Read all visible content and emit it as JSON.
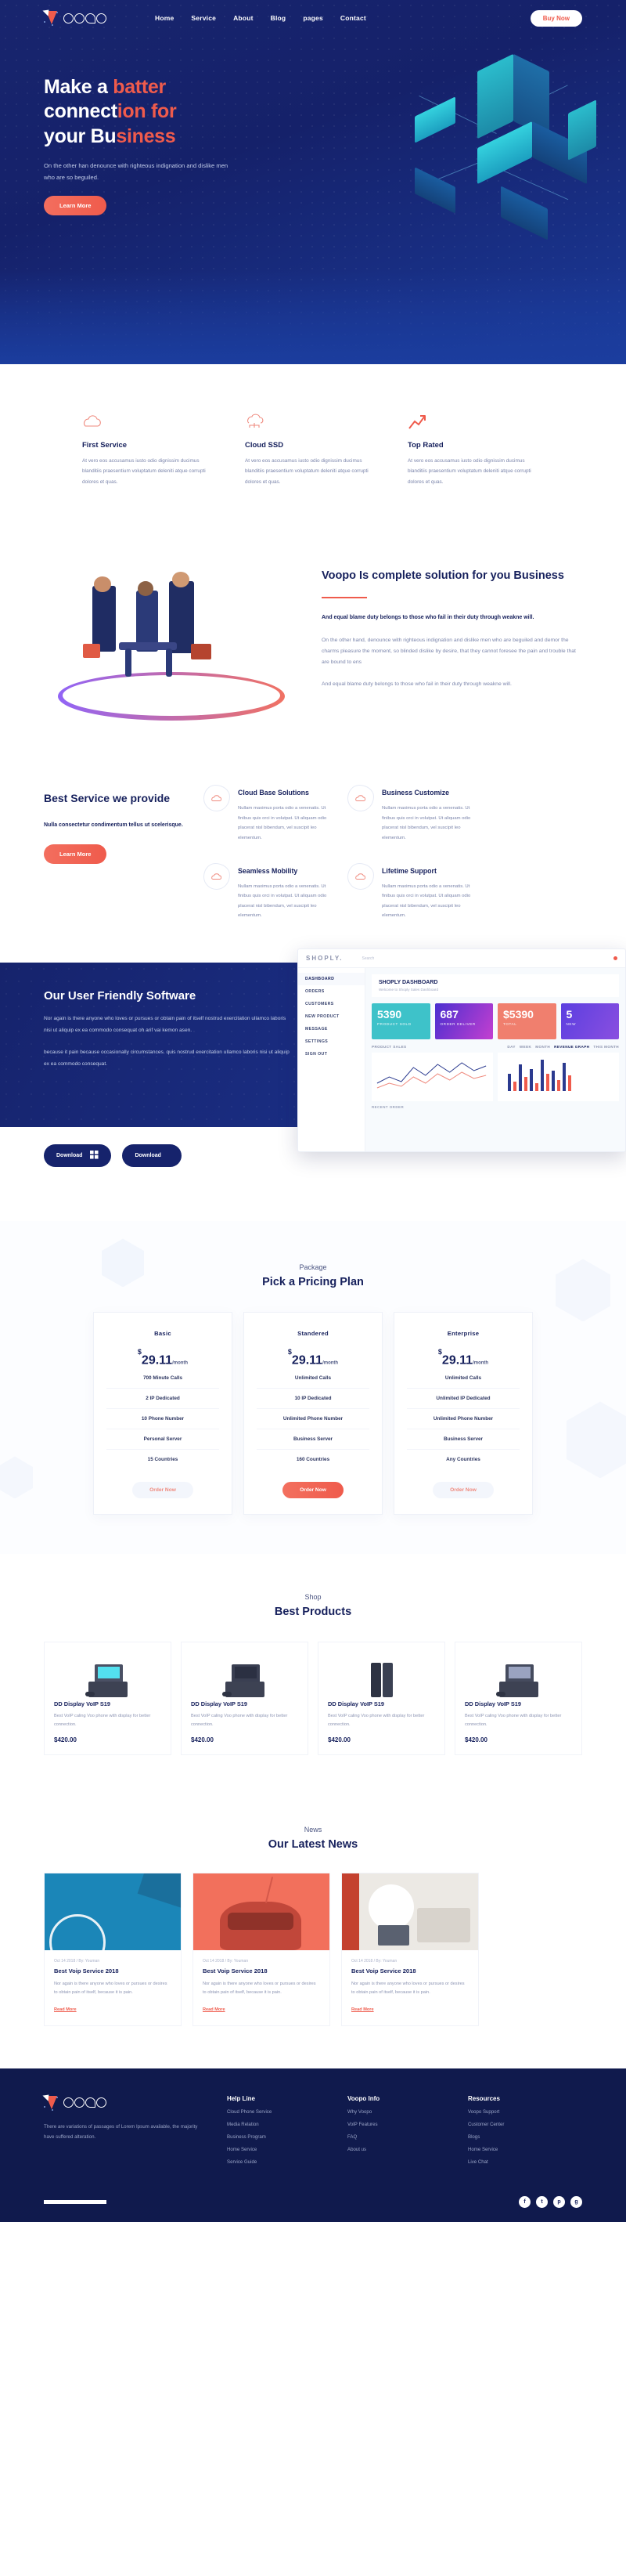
{
  "brand": {
    "name": "voopo"
  },
  "nav": {
    "links": [
      "Home",
      "Service",
      "About",
      "Blog",
      "pages",
      "Contact"
    ],
    "cta": "Buy Now"
  },
  "hero": {
    "title_line1_a": "Make a ",
    "title_line1_b": "batter",
    "title_line2_a": "connect",
    "title_line2_b": "ion for",
    "title_line3_a": "your Bu",
    "title_line3_b": "siness",
    "paragraph": "On the other han denounce with righteous indignation and dislike men who are so beguiled.",
    "button": "Learn More"
  },
  "features": [
    {
      "icon": "cloud-outline-icon",
      "title": "First Service",
      "text": "At vero eos accusamus iusto odio dignissim ducimus blanditiis praesentium voluptatum deleniti atque corrupti dolores et quas."
    },
    {
      "icon": "cloud-network-icon",
      "title": "Cloud SSD",
      "text": "At vero eos accusamus iusto odio dignissim ducimus blanditiis praesentium voluptatum deleniti atque corrupti dolores et quas."
    },
    {
      "icon": "trending-up-icon",
      "title": "Top Rated",
      "text": "At vero eos accusamus iusto odio dignissim ducimus blanditiis praesentium voluptatum deleniti atque corrupti dolores et quas."
    }
  ],
  "solution": {
    "title": "Voopo Is complete solution for you Business",
    "lead": "And equal blame duty belongs to those who fail in their duty through weakne will.",
    "paragraph1": "On the other hand, denounce with righteous indignation and dislike men who are beguiled and demor the charms pleasure the moment, so blinded dislike by desire, that they cannot foresee the pain and trouble that are bound to ens",
    "paragraph2": "And equal blame duty belongs to those who fail in their duty through weakne will."
  },
  "best_service": {
    "title": "Best Service we provide",
    "subtitle": "Nulla consectetur condimentum tellus ut scelerisque.",
    "button": "Learn More",
    "items": [
      {
        "icon": "cloud-icon",
        "title": "Cloud Base Solutions",
        "text": "Nullam maximus porta odio a venenatis. Ut finibus quis orci in volutpat. Ut aliquam odio placerat nisl bibendum, vel suscipit leo elementum."
      },
      {
        "icon": "cloud-icon",
        "title": "Business Customize",
        "text": "Nullam maximus porta odio a venenatis. Ut finibus quis orci in volutpat. Ut aliquam odio placerat nisl bibendum, vel suscipit leo elementum."
      },
      {
        "icon": "cloud-icon",
        "title": "Seamless Mobility",
        "text": "Nullam maximus porta odio a venenatis. Ut finibus quis orci in volutpat. Ut aliquam odio placerat nisl bibendum, vel suscipit leo elementum."
      },
      {
        "icon": "cloud-icon",
        "title": "Lifetime Support",
        "text": "Nullam maximus porta odio a venenatis. Ut finibus quis orci in volutpat. Ut aliquam odio placerat nisl bibendum, vel suscipit leo elementum."
      }
    ]
  },
  "software": {
    "title": "Our User Friendly Software",
    "paragraph1": "Nor again is there anyone who loves or pursues or obtain pain of itself nostrud exercitation ullamco laboris nisi ut aliquip ex ea commodo consequat oh arif vai kemon asen.",
    "paragraph2": "because it pain because occasionally circumstances. quis nostrud exercitation ullamco laboris nisi ut aliquip ex ea commodo consequat.",
    "download_windows": "Download",
    "download_apple": "Download"
  },
  "dashboard": {
    "logo": "SHOPLY.",
    "search_placeholder": "Search",
    "menu": [
      "DASHBOARD",
      "ORDERS",
      "CUSTOMERS",
      "NEW PRODUCT",
      "MESSAGE",
      "SETTINGS",
      "SIGN OUT"
    ],
    "panel_title": "SHOPLY DASHBOARD",
    "panel_sub": "Welcome to Shoply Sales Dashboard",
    "kpis": [
      {
        "value": "5390",
        "label": "PRODUCT SOLD",
        "color": "#3ec2c9"
      },
      {
        "value": "687",
        "label": "ORDER DELIVER",
        "color": "#6a35d4"
      },
      {
        "value": "$5390",
        "label": "TOTAL",
        "color": "#f07f6e"
      },
      {
        "value": "5",
        "label": "NEW",
        "color": "#6f3fe0"
      }
    ],
    "section_left": "PRODUCT SALES",
    "toggles": [
      "DAY",
      "WEEK",
      "MONTH"
    ],
    "section_right": "REVENUE GRAPH",
    "section_right_sub": "THIS MONTH",
    "footer_label": "RECENT ORDER"
  },
  "pricing": {
    "eyebrow": "Package",
    "title": "Pick a Pricing Plan",
    "plans": [
      {
        "name": "Basic",
        "currency": "$",
        "price": "29.11",
        "per": "/month",
        "features": [
          "700 Minute Calls",
          "2 IP Dedicated",
          "10 Phone Number",
          "Personal Server",
          "15 Countries"
        ],
        "button": "Order Now",
        "highlight": false
      },
      {
        "name": "Standered",
        "currency": "$",
        "price": "29.11",
        "per": "/month",
        "features": [
          "Unlimited Calls",
          "10 IP Dedicated",
          "Unlimited Phone Number",
          "Business Server",
          "160 Countries"
        ],
        "button": "Order Now",
        "highlight": true
      },
      {
        "name": "Enterprise",
        "currency": "$",
        "price": "29.11",
        "per": "/month",
        "features": [
          "Unlimited Calls",
          "Unlimited IP Dedicated",
          "Unlimited Phone Number",
          "Business Server",
          "Any Countries"
        ],
        "button": "Order Now",
        "highlight": false
      }
    ]
  },
  "shop": {
    "eyebrow": "Shop",
    "title": "Best Products",
    "products": [
      {
        "name": "DD Display VoIP S19",
        "desc": "Best VoIP caling Voo phone with display for better connection.",
        "price": "$420.00"
      },
      {
        "name": "DD Display VoIP S19",
        "desc": "Best VoIP caling Voo phone with display for better connection.",
        "price": "$420.00"
      },
      {
        "name": "DD Display VoIP S19",
        "desc": "Best VoIP caling Voo phone with display for better connection.",
        "price": "$420.00"
      },
      {
        "name": "DD Display VoIP S19",
        "desc": "Best VoIP caling Voo phone with display for better connection.",
        "price": "$420.00"
      }
    ]
  },
  "news": {
    "eyebrow": "News",
    "title": "Our Latest News",
    "posts": [
      {
        "meta": "Oct 14 2018 / By: Youman",
        "title": "Best Voip Service 2018",
        "text": "Nor again is there anyone who loves or pursues or desires to obtain pain of itself, because it is pain.",
        "link": "Read More"
      },
      {
        "meta": "Oct 14 2018 / By: Youman",
        "title": "Best Voip Service 2018",
        "text": "Nor again is there anyone who loves or pursues or desires to obtain pain of itself, because it is pain.",
        "link": "Read More"
      },
      {
        "meta": "Oct 14 2018 / By: Youman",
        "title": "Best Voip Service 2018",
        "text": "Nor again is there anyone who loves or pursues or desires to obtain pain of itself, because it is pain.",
        "link": "Read More"
      }
    ]
  },
  "footer": {
    "about": "There are variations of passages of Lorem Ipsum available, the majority have suffered alteration.",
    "columns": [
      {
        "title": "Help Line",
        "links": [
          "Cloud Phone Service",
          "Media Relation",
          "Business Program",
          "Home Service",
          "Service Guide"
        ]
      },
      {
        "title": "Voopo Info",
        "links": [
          "Why Voopo",
          "VoIP Features",
          "FAQ",
          "About us"
        ]
      },
      {
        "title": "Resources",
        "links": [
          "Voopo Support",
          "Customer Center",
          "Blogs",
          "Home Service",
          "Live Chat"
        ]
      }
    ],
    "socials": [
      "f",
      "t",
      "p",
      "g"
    ]
  },
  "colors": {
    "navy": "#16205c",
    "deep": "#101a4d",
    "accent": "#ef5b4c",
    "muted": "#7b85ab"
  }
}
